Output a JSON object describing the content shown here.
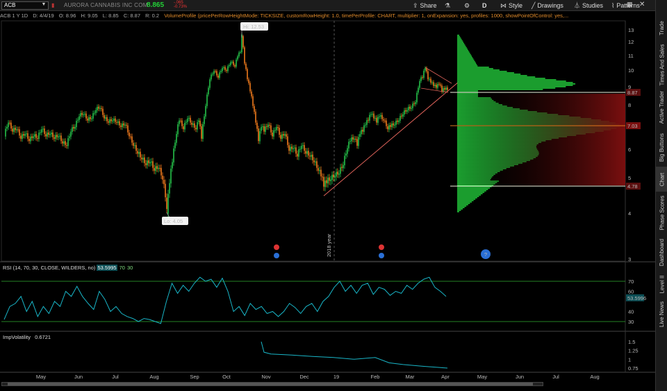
{
  "toolbar": {
    "symbol": "ACB",
    "company": "AURORA CANNABIS INC COM",
    "last_price": "8.865",
    "change_abs": "-.065",
    "change_pct": "-0.73%",
    "share": "Share",
    "style": "Style",
    "drawings": "Drawings",
    "studies": "Studies",
    "patterns": "Patterns",
    "d": "D"
  },
  "status_line": {
    "period": "ACB 1 Y 1D",
    "date": "D: 4/4/19",
    "open": "O: 8.96",
    "high": "H: 9.05",
    "low": "L: 8.85",
    "close": "C: 8.87",
    "range": "R: 0.2",
    "volume_profile": "VolumeProfile (pricePerRowHeightMode: TICKSIZE, customRowHeight: 1.0, timePerProfile: CHART, multiplier: 1, onExpansion: yes, profiles: 1000, showPointOfControl: yes,..."
  },
  "side_tabs": [
    "Trade",
    "Times And Sales",
    "Active Trader",
    "Big Buttons",
    "Chart",
    "Phase Scores",
    "Dashboard",
    "Level II",
    "Live News"
  ],
  "active_tab": "Chart",
  "price_axis": [
    "13",
    "12",
    "11",
    "10",
    "9",
    "8",
    "7",
    "6",
    "5",
    "4",
    "3"
  ],
  "price_markers": [
    "8.87",
    "7.03",
    "4.78"
  ],
  "hi_label": "Hi: 12.53",
  "lo_label": "Lo: 4.05",
  "year_label": "2018 year",
  "months": [
    "May",
    "Jun",
    "Jul",
    "Aug",
    "Sep",
    "Oct",
    "Nov",
    "Dec",
    "19",
    "Feb",
    "Mar",
    "Apr",
    "May",
    "Jun",
    "Jul",
    "Aug"
  ],
  "rsi": {
    "title": "RSI (14, 70, 30, CLOSE, WILDERS, no)",
    "value": "53.5995",
    "overbought": "70",
    "oversold": "30",
    "axis": [
      "70",
      "60",
      "40",
      "30"
    ],
    "marker": "53.5996"
  },
  "impvol": {
    "title": "ImpVolatility",
    "value": "0.6721",
    "axis": [
      "1.5",
      "1.25",
      "1",
      "0.75"
    ]
  },
  "colors": {
    "up": "#25c24a",
    "down": "#f07a1c",
    "trend": "#e0635a",
    "rsi": "#19b6c8",
    "profile": "#22c43a",
    "value_area": "#7a0f0f"
  }
}
